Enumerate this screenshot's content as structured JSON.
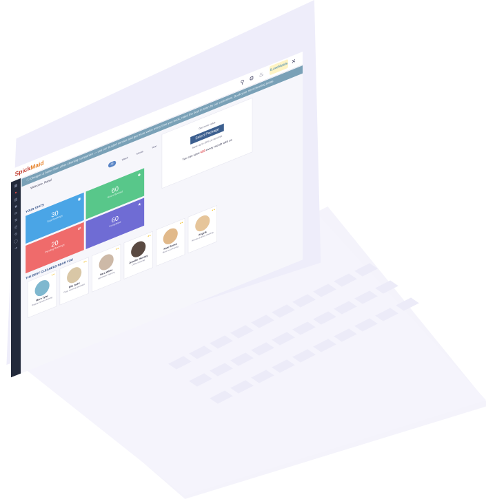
{
  "app": {
    "logo_part1": "Spick",
    "logo_part2": "Maid",
    "partner_badge": "ILoveMaids"
  },
  "announcement": "Cheaper & better than other cleaning companies — use our trusted service and get more value every time you book, rated the best in town by our customers. Book your next cleaning today.",
  "welcome": "Welcome, Rahel",
  "filters": [
    "All",
    "Week",
    "Month",
    "Year"
  ],
  "sections": {
    "statistics": "YOUR STATS",
    "team": "THE BEST CLEANERS NEAR YOU"
  },
  "tiles": [
    {
      "value": "30",
      "label": "Total Bookings",
      "color": "#4aa5e6",
      "icon": "eye-icon"
    },
    {
      "value": "60",
      "label": "Hours Booked",
      "color": "#58c78a",
      "icon": "user-icon"
    },
    {
      "value": "20",
      "label": "Pending Bookings",
      "color": "#ef6b6b",
      "icon": "chat-icon"
    },
    {
      "value": "60",
      "label": "Completed",
      "color": "#6f6cd4",
      "icon": "star-icon"
    }
  ],
  "promo": {
    "kicker": "Get more value",
    "button": "Select Package",
    "small": "Save up to 25% on services",
    "offer_prefix": "You can save",
    "offer_value": "€50",
    "offer_suffix": "every month with us"
  },
  "cleaners": [
    {
      "name": "Mare Tyler",
      "role": "Regular house cleaning",
      "avatar_color": "#7fb8cf"
    },
    {
      "name": "Ella Judd",
      "role": "Deep cleaning specialist",
      "avatar_color": "#d9c7a6"
    },
    {
      "name": "Sara White",
      "role": "Apartment cleaning",
      "avatar_color": "#cdb9a7"
    },
    {
      "name": "Jennifer Huntley",
      "role": "Office cleaning",
      "avatar_color": "#5a4a42"
    },
    {
      "name": "Kate Brown",
      "role": "Move-out cleaning",
      "avatar_color": "#e1b98a"
    },
    {
      "name": "Angela",
      "role": "Window & glass cleaning",
      "avatar_color": "#e6c59a"
    }
  ],
  "colors": {
    "sidebar": "#232a3b",
    "announcement_bar": "#7aa1b7",
    "accent": "#5b86c6"
  }
}
